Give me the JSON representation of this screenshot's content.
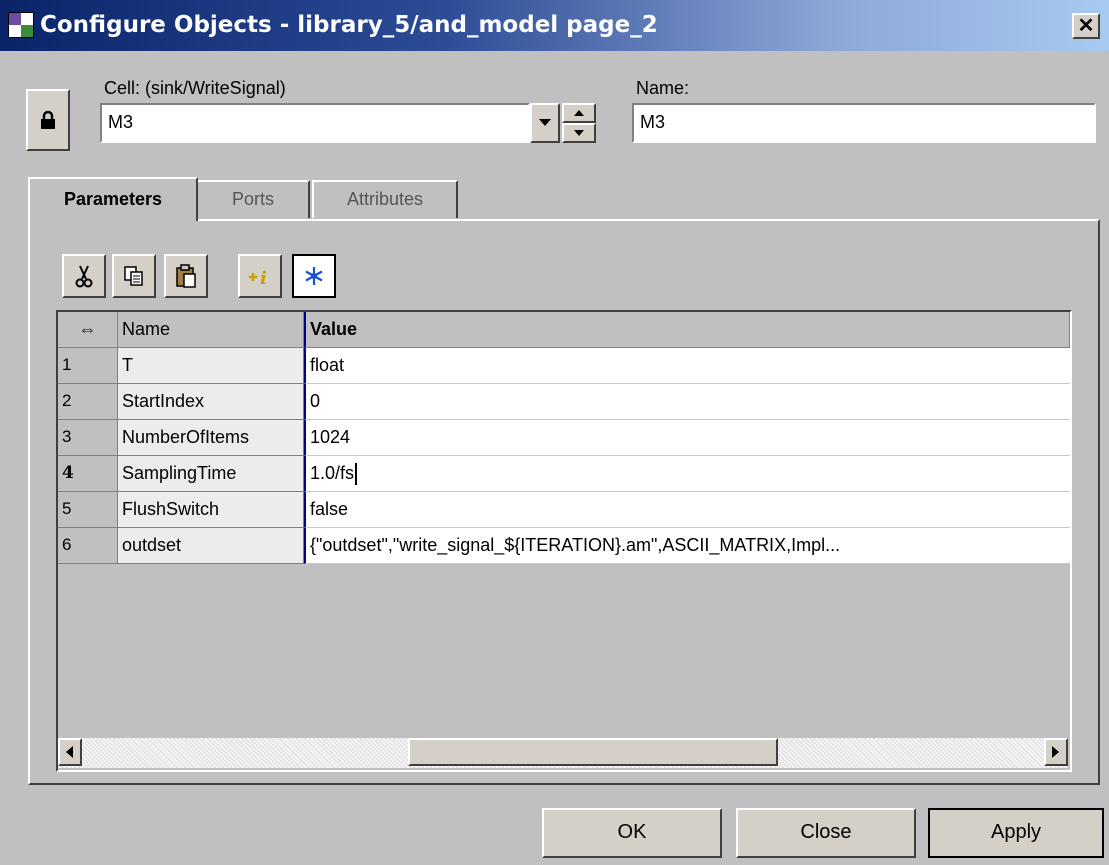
{
  "window": {
    "title": "Configure Objects - library_5/and_model page_2",
    "close_glyph": "✕"
  },
  "cell": {
    "label": "Cell: (sink/WriteSignal)",
    "value": "M3"
  },
  "name_field": {
    "label": "Name:",
    "value": "M3"
  },
  "tabs": [
    {
      "label": "Parameters",
      "active": true
    },
    {
      "label": "Ports",
      "active": false
    },
    {
      "label": "Attributes",
      "active": false
    }
  ],
  "toolbar": {
    "icons": [
      "scissors-icon",
      "copy-icon",
      "paste-icon",
      "add-info-icon",
      "snowflake-icon"
    ]
  },
  "table": {
    "corner_glyph": "⇔",
    "headers": [
      "Name",
      "Value"
    ],
    "rows": [
      {
        "num": "1",
        "name": "T",
        "value": "float"
      },
      {
        "num": "2",
        "name": "StartIndex",
        "value": "0"
      },
      {
        "num": "3",
        "name": "NumberOfItems",
        "value": "1024"
      },
      {
        "num": "4",
        "name": "SamplingTime",
        "value": "1.0/fs"
      },
      {
        "num": "5",
        "name": "FlushSwitch",
        "value": "false"
      },
      {
        "num": "6",
        "name": "outdset",
        "value": "{\"outdset\",\"write_signal_${ITERATION}.am\",ASCII_MATRIX,Impl..."
      }
    ]
  },
  "buttons": {
    "ok": "OK",
    "close": "Close",
    "apply": "Apply"
  },
  "colors": {
    "titlebar_start": "#0a246a",
    "titlebar_end": "#a6caf0",
    "dialog_bg": "#c0c0c0",
    "active_cell_border": "#00008b"
  }
}
